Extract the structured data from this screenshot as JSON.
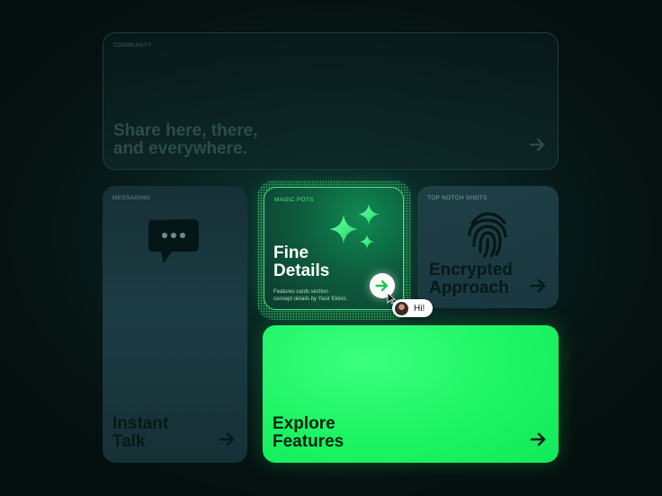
{
  "cards": {
    "community": {
      "eyebrow": "COMMUNITY",
      "title_line1": "Share here, there,",
      "title_line2": "and everywhere."
    },
    "messaging": {
      "eyebrow": "MESSAGING",
      "title_line1": "Instant",
      "title_line2": "Talk"
    },
    "magic": {
      "eyebrow": "MAGIC POTS",
      "title_line1": "Fine",
      "title_line2": "Details",
      "caption_line1": "Features cards section",
      "caption_line2": "concept details by Yasir Ekinci."
    },
    "topnotch": {
      "eyebrow": "TOP NOTCH SHOTS",
      "title_line1": "Encrypted",
      "title_line2": "Approach"
    },
    "explore": {
      "title_line1": "Explore",
      "title_line2": "Features"
    }
  },
  "tooltip": {
    "text": "Hi!"
  },
  "icons": {
    "community_arrow": "arrow-right-icon",
    "messaging": "chat-bubble-icon",
    "magic": "sparkles-icon",
    "topnotch": "fingerprint-icon",
    "cursor": "mouse-pointer-icon"
  },
  "colors": {
    "background": "#061514",
    "accent_green": "#1df463",
    "card_teal": "#1c3c44",
    "magic_border": "#4fdc86"
  }
}
